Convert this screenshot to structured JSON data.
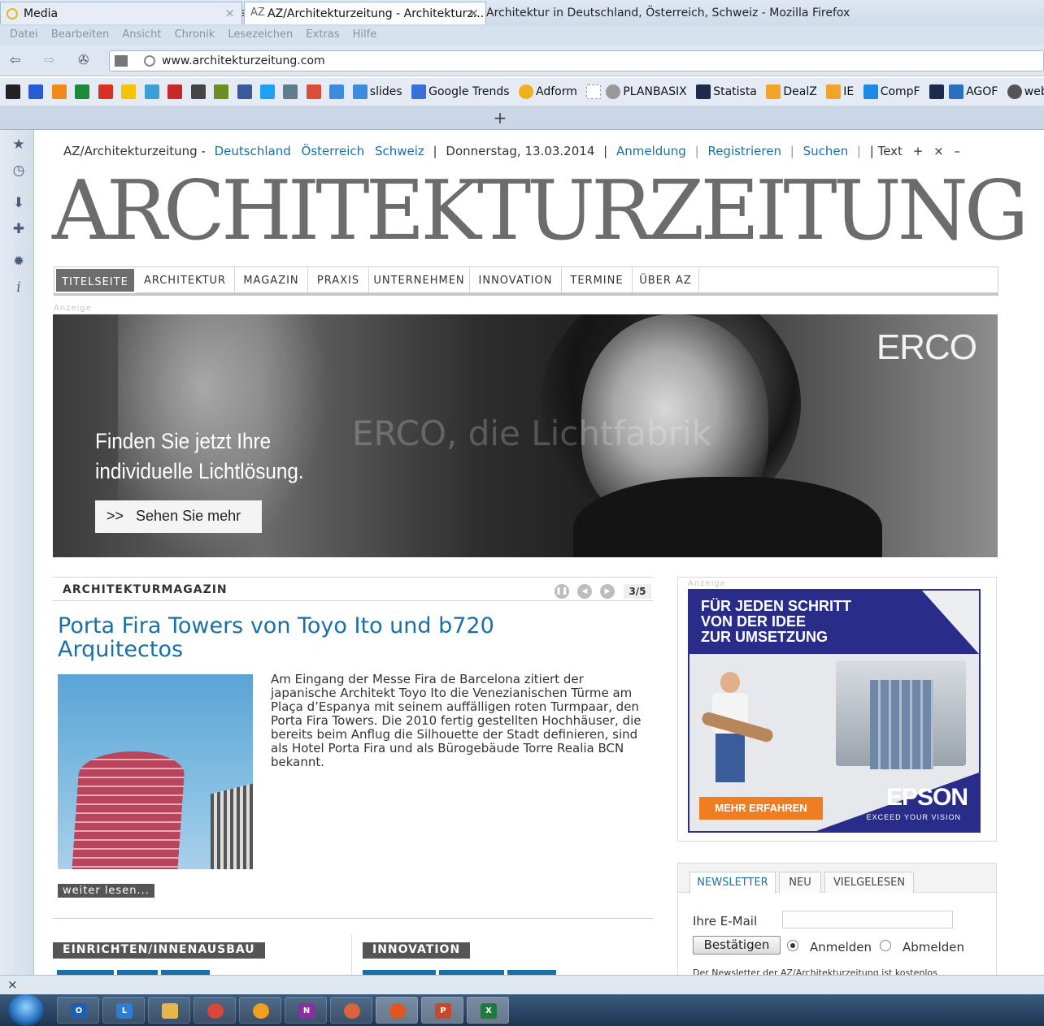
{
  "window": {
    "title": "AZ/Architekturzeitung - Architekturzeitschrift und Kulturmagazin für Architekten - Architektur in Deutschland, Österreich, Schweiz - Mozilla Firefox",
    "menu": [
      "Datei",
      "Bearbeiten",
      "Ansicht",
      "Chronik",
      "Lesezeichen",
      "Extras",
      "Hilfe"
    ],
    "url": "www.architekturzeitung.com"
  },
  "bookmarks": [
    {
      "label": "slides",
      "icon": "dropbox-icon",
      "color": "#3d8be0"
    },
    {
      "label": "Google Trends",
      "icon": "google-trends-icon",
      "color": "#3b6fd8"
    },
    {
      "label": "Adform",
      "icon": "circle-icon",
      "color": "#f2b01e"
    },
    {
      "label": "PLANBASIX",
      "icon": "tag-icon",
      "color": "#999999"
    },
    {
      "label": "Statista",
      "icon": "statista-icon",
      "color": "#1d2b4a"
    },
    {
      "label": "DealZ",
      "icon": "rss-icon",
      "color": "#f0a52a"
    },
    {
      "label": "IE",
      "icon": "rss-icon",
      "color": "#f0a52a"
    },
    {
      "label": "CompF",
      "icon": "c-icon",
      "color": "#1e88e5"
    },
    {
      "label": "AGOF",
      "icon": "chart-icon",
      "color": "#1d2b4a"
    },
    {
      "label": "websitelooker",
      "icon": "globe-icon",
      "color": "#555555"
    }
  ],
  "tabs": [
    {
      "label": "Media",
      "active": false
    },
    {
      "label": "AZ/Architekturzeitung - Architekturz...",
      "active": true
    }
  ],
  "site": {
    "top": {
      "brand": "AZ/Architekturzeitung -",
      "countries": [
        "Deutschland",
        "Österreich",
        "Schweiz"
      ],
      "date": "Donnerstag, 13.03.2014",
      "links": [
        "Anmeldung",
        "Registrieren",
        "Suchen"
      ],
      "text_size": "Text",
      "text_controls": [
        "+",
        "×",
        "–"
      ]
    },
    "logo": "ARCHITEKTURZEITUNG",
    "nav": [
      "TITELSEITE",
      "ARCHITEKTUR",
      "MAGAZIN",
      "PRAXIS",
      "UNTERNEHMEN",
      "INNOVATION",
      "TERMINE",
      "ÜBER AZ"
    ],
    "ad_label": "Anzeige",
    "hero": {
      "brand": "ERCO",
      "watermark": "ERCO, die Lichtfabrik",
      "headline_1": "Finden Sie jetzt Ihre",
      "headline_2": "individuelle Lichtlösung.",
      "cta": ">>   Sehen Sie mehr"
    },
    "magazine": {
      "section": "ARCHITEKTURMAGAZIN",
      "pager": "3/5",
      "title": "Porta Fira Towers von Toyo Ito und b720 Arquitectos",
      "text": "Am Eingang der Messe Fira de Barcelona zitiert der japanische Architekt Toyo Ito die Venezianischen Türme am Plaça d’Espanya mit seinem auffälligen roten Turmpaar, den Porta Fira Towers. Die 2010 fertig gestellten Hochhäuser, die bereits beim Anflug die Silhouette der Stadt definieren, sind als Hotel Porta Fira und als Bürogebäude Torre Realia BCN bekannt.",
      "more": "weiter lesen..."
    },
    "categories": [
      "EINRICHTEN/INNENAUSBAU",
      "INNOVATION"
    ],
    "epson_ad": {
      "headline_1": "FÜR JEDEN SCHRITT",
      "headline_2": "VON DER IDEE",
      "headline_3": "ZUR UMSETZUNG",
      "button": "MEHR ERFAHREN",
      "logo": "EPSON",
      "slogan": "EXCEED YOUR VISION"
    },
    "newsletter": {
      "tabs": [
        "NEWSLETTER",
        "NEU",
        "VIELGELESEN"
      ],
      "email_label": "Ihre E-Mail",
      "email_value": "",
      "submit": "Bestätigen",
      "options": [
        "Anmelden",
        "Abmelden"
      ],
      "selected": "Anmelden",
      "note": "Der Newsletter der AZ/Architekturzeitung ist kostenlos"
    }
  },
  "taskbar": [
    {
      "icon": "outlook-icon",
      "color": "#1f5fb0",
      "label": "O"
    },
    {
      "icon": "lync-icon",
      "color": "#2a7fd0",
      "label": "L"
    },
    {
      "icon": "explorer-icon",
      "color": "#e6b64a",
      "label": ""
    },
    {
      "icon": "chrome-icon",
      "color": "#d9473b",
      "label": ""
    },
    {
      "icon": "app-icon",
      "color": "#f0a020",
      "label": ""
    },
    {
      "icon": "onenote-icon",
      "color": "#8a2fa2",
      "label": "N"
    },
    {
      "icon": "paint-icon",
      "color": "#d9633a",
      "label": ""
    },
    {
      "icon": "firefox-icon",
      "color": "#e2551c",
      "label": ""
    },
    {
      "icon": "powerpoint-icon",
      "color": "#c9472b",
      "label": "P"
    },
    {
      "icon": "excel-icon",
      "color": "#1f7a3e",
      "label": "X"
    }
  ]
}
